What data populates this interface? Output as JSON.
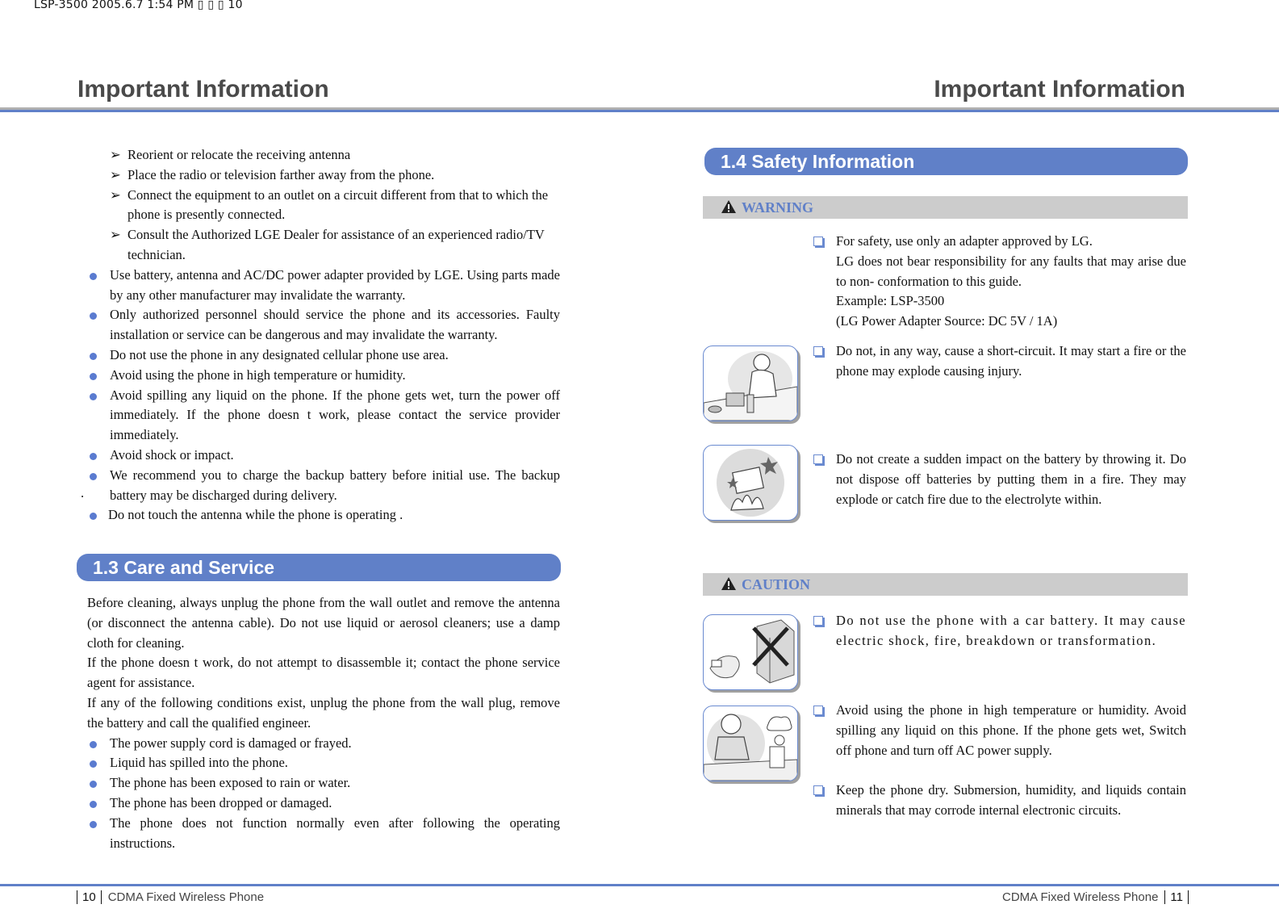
{
  "meta_line": "LSP-3500  2005.6.7 1:54 PM  ▯ ▯ ▯ 10",
  "header": {
    "left_title": "Important Information",
    "right_title": "Important Information"
  },
  "footer": {
    "left_page": "10",
    "left_text": "CDMA Fixed Wireless  Phone",
    "right_text": "CDMA Fixed Wireless  Phone",
    "right_page": "11"
  },
  "left_page": {
    "sub_items": [
      "Reorient or relocate the receiving antenna",
      "Place the radio or television farther away from the phone.",
      "Connect the equipment to an outlet on a circuit different from that to which the phone is presently connected.",
      "Consult the Authorized LGE Dealer for assistance of an experienced radio/TV technician."
    ],
    "sub_arrow": "➢",
    "bullets": [
      "Use battery, antenna and AC/DC power adapter provided by LGE. Using parts made by any other manufacturer may invalidate the warranty.",
      "Only authorized personnel should service the phone and its accessories. Faulty installation or service can be dangerous and may invalidate the warranty.",
      "Do not use the phone in any designated  cellular phone use  area.",
      "Avoid using the phone in high temperature or humidity.",
      "Avoid spilling any liquid on the phone. If the phone gets wet, turn the power off immediately. If the phone doesn t work, please contact the service provider immediately.",
      "Avoid shock or impact.",
      "We recommend you to charge the backup battery before initial use. The backup battery may be discharged during delivery.",
      "Do not touch the antenna while the phone is operating ."
    ],
    "stray_mark": ".",
    "section_13": {
      "title": "1.3   Care and Service",
      "paragraphs": [
        "Before cleaning, always unplug the phone from the wall outlet and remove the antenna (or disconnect the antenna cable). Do not use liquid or aerosol cleaners; use a damp cloth for cleaning.",
        "If the phone doesn t work, do not attempt to disassemble it; contact the phone service agent for assistance.",
        "If any of the following conditions exist, unplug the phone from the wall plug, remove the battery and call the qualified engineer."
      ],
      "conditions": [
        "The power supply cord is damaged or frayed.",
        "Liquid has spilled into the phone.",
        "The phone has been exposed to rain or water.",
        "The phone has been dropped or damaged.",
        "The phone does not function normally even after following the operating instructions."
      ]
    }
  },
  "right_page": {
    "section_14": {
      "title": "1.4   Safety Information"
    },
    "warning": {
      "label": "WARNING",
      "items": [
        {
          "lines": [
            "For safety, use only an adapter approved by LG.",
            "LG does not bear responsibility for any faults that may arise due to non- conformation to this guide.",
            "Example: LSP-3500",
            "(LG Power Adapter Source: DC 5V / 1A)"
          ]
        },
        {
          "text": "Do not, in any way, cause a short-circuit. It may start a fire or the phone may explode causing injury."
        },
        {
          "text": "Do not create a sudden impact on the battery by throwing it. Do not dispose off batteries by putting them in a fire. They may explode or catch fire due to the electrolyte within."
        }
      ]
    },
    "caution": {
      "label": "CAUTION",
      "items": [
        {
          "text": "Do not use the phone with a car battery.  It may cause electric shock, fire, breakdown or transformation."
        },
        {
          "text": "Avoid using the phone in high temperature or humidity. Avoid spilling any liquid on this phone. If the phone gets wet, Switch off phone and turn off AC power supply."
        },
        {
          "text": "Keep the phone dry. Submersion, humidity, and liquids contain minerals that may corrode internal electronic circuits."
        }
      ]
    },
    "colors": {
      "accent": "#6080c8",
      "alert_bar": "#cccccc",
      "title_gray": "#4a4a4a"
    }
  }
}
